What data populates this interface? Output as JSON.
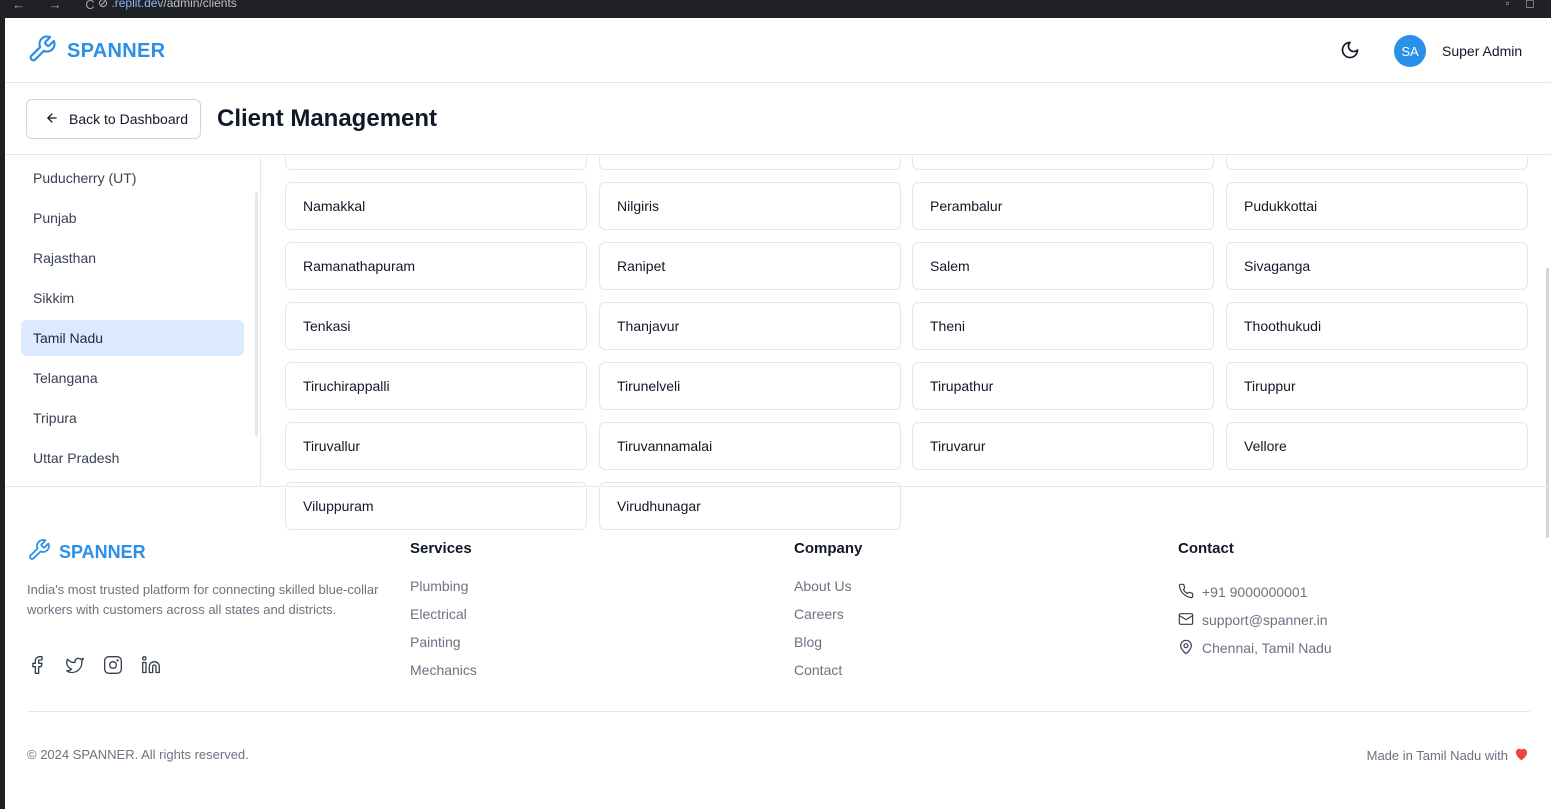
{
  "browser": {
    "nav_glyphs": "← → C",
    "url_host": ".replit.dev",
    "url_path": "/admin/clients",
    "url_prefix": "⊘ "
  },
  "header": {
    "brand": "SPANNER",
    "user_initials": "SA",
    "user_name": "Super Admin"
  },
  "titlebar": {
    "back_label": "Back to Dashboard",
    "title": "Client Management"
  },
  "sidebar": {
    "states": [
      {
        "label": "Puducherry (UT)",
        "active": false
      },
      {
        "label": "Punjab",
        "active": false
      },
      {
        "label": "Rajasthan",
        "active": false
      },
      {
        "label": "Sikkim",
        "active": false
      },
      {
        "label": "Tamil Nadu",
        "active": true
      },
      {
        "label": "Telangana",
        "active": false
      },
      {
        "label": "Tripura",
        "active": false
      },
      {
        "label": "Uttar Pradesh",
        "active": false
      }
    ]
  },
  "districts": [
    "Namakkal",
    "Nilgiris",
    "Perambalur",
    "Pudukkottai",
    "Ramanathapuram",
    "Ranipet",
    "Salem",
    "Sivaganga",
    "Tenkasi",
    "Thanjavur",
    "Theni",
    "Thoothukudi",
    "Tiruchirappalli",
    "Tirunelveli",
    "Tirupathur",
    "Tiruppur",
    "Tiruvallur",
    "Tiruvannamalai",
    "Tiruvarur",
    "Vellore",
    "Viluppuram",
    "Virudhunagar"
  ],
  "footer": {
    "brand": "SPANNER",
    "description": "India's most trusted platform for connecting skilled blue-collar workers with customers across all states and districts.",
    "socials": [
      "facebook-icon",
      "twitter-icon",
      "instagram-icon",
      "linkedin-icon"
    ],
    "services": {
      "heading": "Services",
      "links": [
        "Plumbing",
        "Electrical",
        "Painting",
        "Mechanics"
      ]
    },
    "company": {
      "heading": "Company",
      "links": [
        "About Us",
        "Careers",
        "Blog",
        "Contact"
      ]
    },
    "contact": {
      "heading": "Contact",
      "phone": "+91 9000000001",
      "email": "support@spanner.in",
      "address": "Chennai, Tamil Nadu"
    },
    "copyright": "© 2024 SPANNER. All rights reserved.",
    "made_in": "Made in Tamil Nadu with"
  },
  "colors": {
    "brand": "#2a90e8",
    "active_bg": "#dbeafe",
    "heart": "#ef4444"
  }
}
